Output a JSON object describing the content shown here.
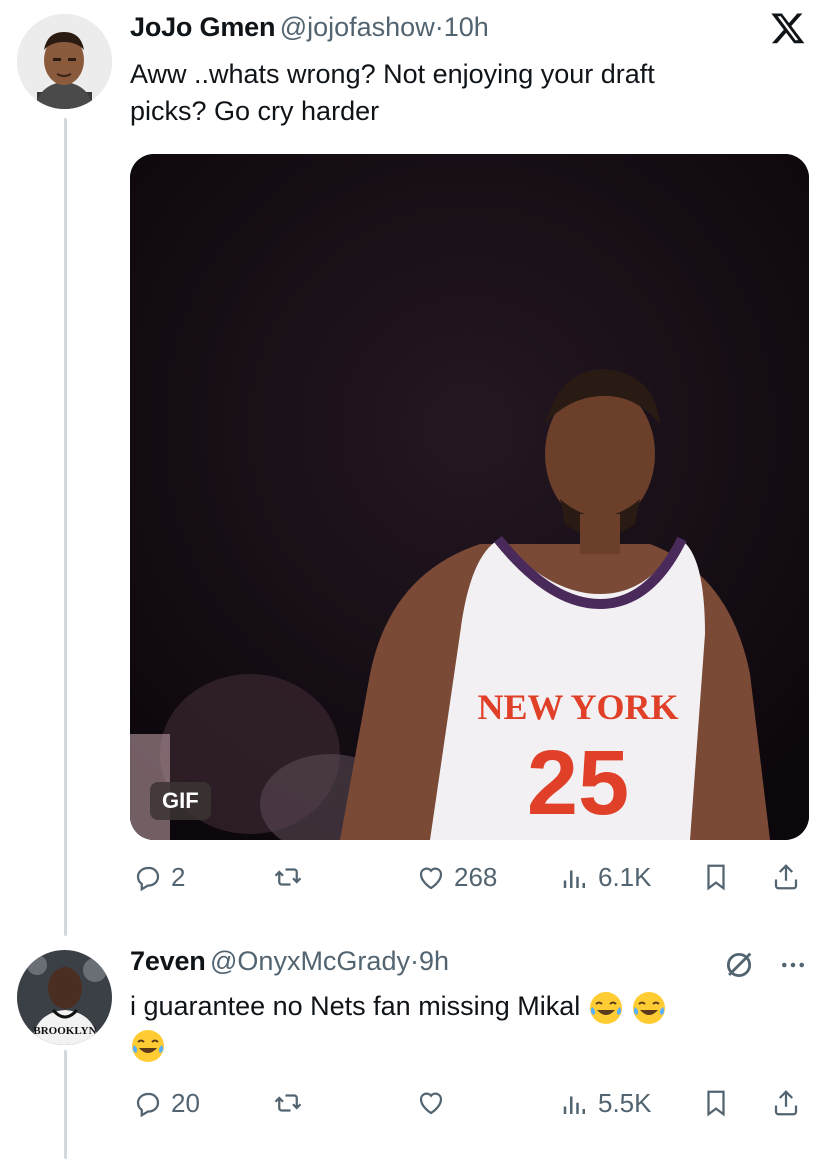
{
  "logo": {
    "icon": "x-logo-icon"
  },
  "tweet1": {
    "display_name": "JoJo Gmen",
    "handle": "@jojofashow",
    "separator": "·",
    "time": "10h",
    "text_line1": "Aww ..whats wrong? Not enjoying your draft",
    "text_line2": "picks? Go cry harder",
    "media": {
      "badge": "GIF",
      "jersey_text": "NEW YORK",
      "jersey_number": "25"
    },
    "actions": {
      "replies": "2",
      "reposts": "",
      "likes": "268",
      "views": "6.1K"
    }
  },
  "tweet2": {
    "display_name": "7even",
    "handle": "@OnyxMcGrady",
    "separator": "·",
    "time": "9h",
    "text": "i guarantee no Nets fan missing Mikal",
    "avatar_text": "BROOKLYN",
    "emojis": [
      "face-with-tears-of-joy",
      "face-with-tears-of-joy",
      "face-with-tears-of-joy"
    ],
    "actions": {
      "replies": "20",
      "reposts": "",
      "likes": "",
      "views": "5.5K"
    }
  },
  "colors": {
    "text": "#0f1419",
    "muted": "#536471",
    "thread": "#cfd9de"
  }
}
